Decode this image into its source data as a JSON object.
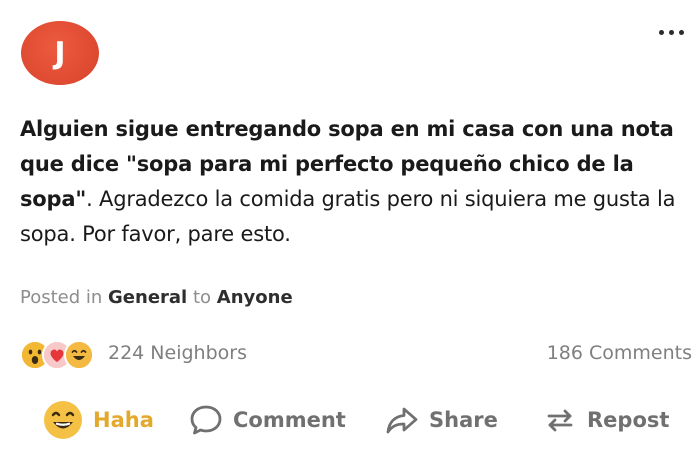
{
  "post": {
    "avatar_letter": "J",
    "avatar_color": "#de4a31",
    "more_icon": "more-horizontal-icon",
    "body_bold": "Alguien sigue entregando sopa en mi casa con una nota que dice \"sopa para mi perfecto pequeño chico de la sopa\"",
    "body_rest": ". Agradezco la comida gratis pero ni siquiera me gusta la sopa.  Por favor, pare esto.",
    "meta": {
      "posted_in_text": "Posted in",
      "category": "General",
      "to_text": "to",
      "audience": "Anyone"
    },
    "reactions": {
      "icons": [
        "wow-emoji-icon",
        "heart-emoji-icon",
        "haha-emoji-icon"
      ],
      "neighbors_label": "224 Neighbors",
      "comments_label": "186 Comments"
    },
    "actions": {
      "haha_label": "Haha",
      "comment_label": "Comment",
      "share_label": "Share",
      "repost_label": "Repost"
    },
    "colors": {
      "haha_accent": "#e4a92c",
      "muted_text": "#8d8d8d"
    }
  }
}
